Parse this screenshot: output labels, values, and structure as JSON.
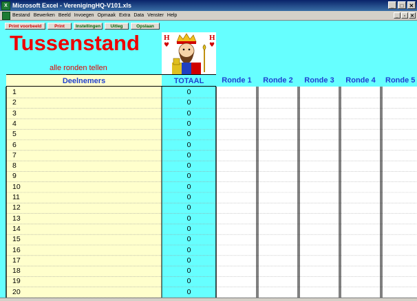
{
  "window": {
    "title": "Microsoft Excel - VerenigingHQ-V101.xls",
    "app_icon": "excel-icon"
  },
  "menu": [
    "Bestand",
    "Bewerken",
    "Beeld",
    "Invoegen",
    "Opmaak",
    "Extra",
    "Data",
    "Venster",
    "Help"
  ],
  "toolbar_buttons": [
    {
      "label": "Print voorbeeld",
      "color": "red"
    },
    {
      "label": "Print",
      "color": "red"
    },
    {
      "label": "Instellingen",
      "color": "green"
    },
    {
      "label": "Uitleg",
      "color": "green"
    },
    {
      "label": "Opslaan",
      "color": "green"
    }
  ],
  "sheet": {
    "title": "Tussenstand",
    "subtitle": "alle ronden tellen",
    "headers": {
      "deelnemers": "Deelnemers",
      "totaal": "TOTAAL",
      "rondes": [
        "Ronde 1",
        "Ronde 2",
        "Ronde 3",
        "Ronde 4",
        "Ronde 5"
      ]
    },
    "rows": [
      {
        "n": "1",
        "total": "0"
      },
      {
        "n": "2",
        "total": "0"
      },
      {
        "n": "3",
        "total": "0"
      },
      {
        "n": "4",
        "total": "0"
      },
      {
        "n": "5",
        "total": "0"
      },
      {
        "n": "6",
        "total": "0"
      },
      {
        "n": "7",
        "total": "0"
      },
      {
        "n": "8",
        "total": "0"
      },
      {
        "n": "9",
        "total": "0"
      },
      {
        "n": "10",
        "total": "0"
      },
      {
        "n": "11",
        "total": "0"
      },
      {
        "n": "12",
        "total": "0"
      },
      {
        "n": "13",
        "total": "0"
      },
      {
        "n": "14",
        "total": "0"
      },
      {
        "n": "15",
        "total": "0"
      },
      {
        "n": "16",
        "total": "0"
      },
      {
        "n": "17",
        "total": "0"
      },
      {
        "n": "18",
        "total": "0"
      },
      {
        "n": "19",
        "total": "0"
      },
      {
        "n": "20",
        "total": "0"
      }
    ]
  },
  "card": {
    "icon": "king-of-hearts-card-icon",
    "corner_letter": "H"
  },
  "colors": {
    "background": "#66ffff",
    "title": "#ee0000",
    "header_text": "#1f3fd0",
    "name_column": "#ffffcc",
    "total_column": "#66ffff"
  }
}
